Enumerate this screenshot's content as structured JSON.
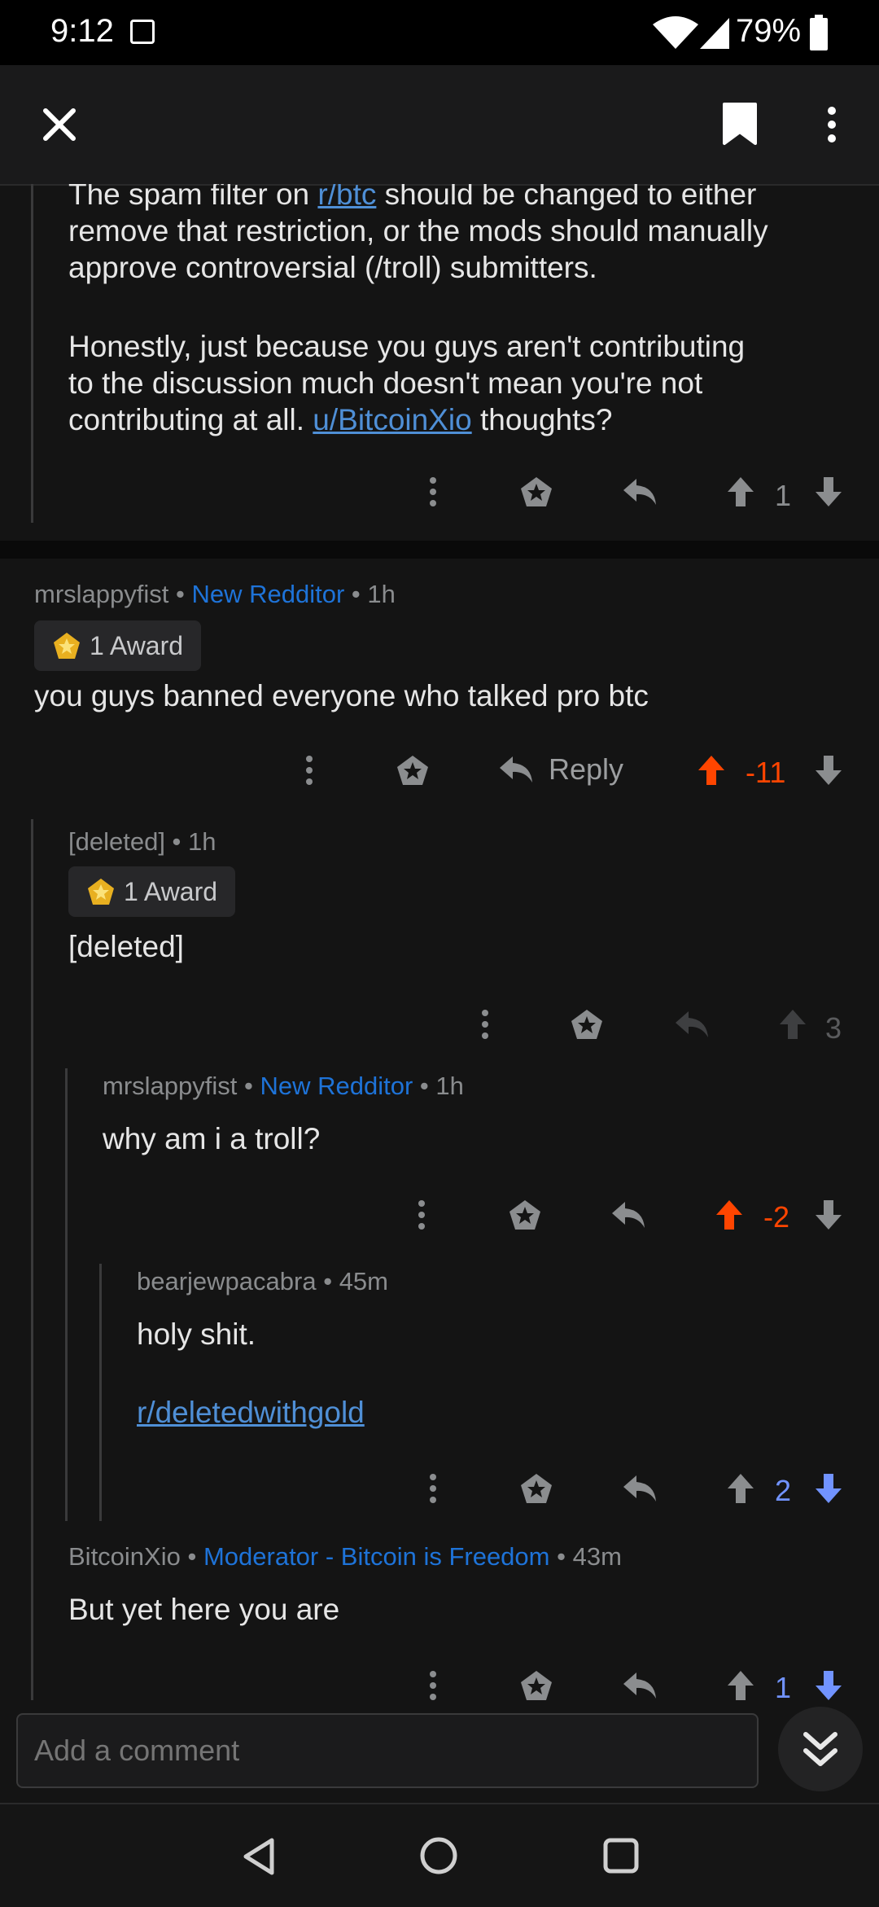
{
  "status": {
    "time": "9:12",
    "battery": "79%"
  },
  "top_comment_partial": {
    "line1_pre": "The spam filter on ",
    "line1_link": "r/btc",
    "line1_post": " should be changed to either",
    "line2": "remove that restriction, or the mods should manually",
    "line3": "approve controversial (/troll) submitters.",
    "line4": "Honestly, just because you guys aren't contributing",
    "line5": "to the discussion much doesn't mean you're not",
    "line6_pre": "contributing at all. ",
    "line6_link": "u/BitcoinXio",
    "line6_post": " thoughts?",
    "score": "1"
  },
  "comments": [
    {
      "author": "mrslappyfist",
      "flair": "New Redditor",
      "time": "1h",
      "award": "1 Award",
      "body": "you guys banned everyone who talked pro btc",
      "reply_label": "Reply",
      "score": "-11"
    },
    {
      "author": "[deleted]",
      "time": "1h",
      "award": "1 Award",
      "body": "[deleted]",
      "score": "3"
    },
    {
      "author": "mrslappyfist",
      "flair": "New Redditor",
      "time": "1h",
      "body": "why am i a troll?",
      "score": "-2"
    },
    {
      "author": "bearjewpacabra",
      "time": "45m",
      "body": "holy shit.",
      "link": "r/deletedwithgold",
      "score": "2"
    },
    {
      "author": "BitcoinXio",
      "flair": "Moderator - Bitcoin is Freedom",
      "time": "43m",
      "body": "But yet here you are",
      "score": "1"
    }
  ],
  "comment_input": {
    "placeholder": "Add a comment"
  },
  "colors": {
    "upvote": "#ff4500",
    "downvote": "#7193ff",
    "link": "#4f8fd6",
    "flair": "#1e73d8"
  }
}
